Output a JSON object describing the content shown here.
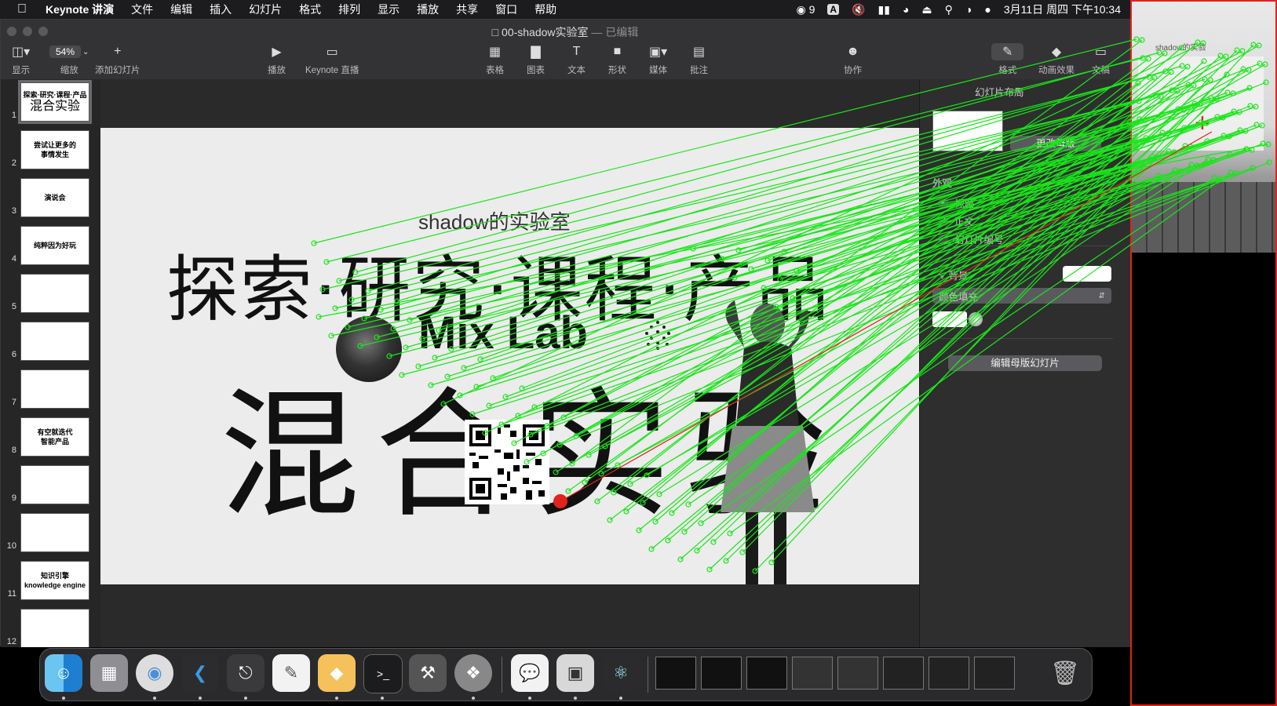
{
  "menubar": {
    "apple_icon": "apple-logo",
    "app_name": "Keynote 讲演",
    "items": [
      "文件",
      "编辑",
      "插入",
      "幻灯片",
      "格式",
      "排列",
      "显示",
      "播放",
      "共享",
      "窗口",
      "帮助"
    ],
    "status": {
      "wechat_count": "9",
      "input_method": "A",
      "datetime": "3月11日 周四 下午10:34"
    }
  },
  "window": {
    "title": "00-shadow实验室",
    "title_sep": " — ",
    "title_status": "已编辑"
  },
  "toolbar": {
    "view_label": "显示",
    "zoom_value": "54%",
    "zoom_label": "缩放",
    "add_slide_label": "添加幻灯片",
    "play_label": "播放",
    "live_label": "Keynote 直播",
    "table_label": "表格",
    "chart_label": "图表",
    "text_label": "文本",
    "shape_label": "形状",
    "media_label": "媒体",
    "comment_label": "批注",
    "collab_label": "协作",
    "format_label": "格式",
    "animate_label": "动画效果",
    "document_label": "文稿"
  },
  "navigator": {
    "slides": [
      {
        "num": "1",
        "line1": "探索·研究·课程·产品",
        "line2": "混合实验"
      },
      {
        "num": "2",
        "line1": "尝试让更多的",
        "line2": "事情发生"
      },
      {
        "num": "3",
        "line1": "演说会",
        "line2": ""
      },
      {
        "num": "4",
        "line1": "纯粹因为好玩",
        "line2": ""
      },
      {
        "num": "5",
        "line1": "",
        "line2": ""
      },
      {
        "num": "6",
        "line1": "",
        "line2": ""
      },
      {
        "num": "7",
        "line1": "",
        "line2": ""
      },
      {
        "num": "8",
        "line1": "有空就迭代",
        "line2": "智能产品"
      },
      {
        "num": "9",
        "line1": "",
        "line2": ""
      },
      {
        "num": "10",
        "line1": "",
        "line2": ""
      },
      {
        "num": "11",
        "line1": "知识引擎",
        "line2": "knowledge engine"
      },
      {
        "num": "12",
        "line1": "",
        "line2": ""
      }
    ]
  },
  "slide": {
    "subtitle": "shadow的实验室",
    "title": "探索·研究·课程·产品",
    "lab": "Mix Lab",
    "big_title": "混合实验"
  },
  "inspector": {
    "header": "幻灯片布局",
    "change_master": "更改母版",
    "appearance": "外观",
    "check_title": "标题",
    "check_body": "正文",
    "check_slide_number": "幻灯片编号",
    "background": "背景",
    "fill_type": "颜色填充",
    "edit_master": "编辑母版幻灯片"
  },
  "right_panel": {
    "overlay_text": "shadow的实验"
  },
  "colors": {
    "match_lines": "#19e619",
    "red_accent": "#e0231c",
    "menubar": "#1c1c1e",
    "toolbar": "#333336"
  },
  "dock": {
    "apps": [
      "finder-icon",
      "launchpad-icon",
      "chrome-icon",
      "vscode-icon",
      "keynote-icon",
      "pages-icon",
      "sketch-icon",
      "terminal-icon",
      "instruments-icon",
      "safari-icon",
      "wechat-icon",
      "preview-icon",
      "electron-icon"
    ],
    "trash": "trash-icon"
  }
}
